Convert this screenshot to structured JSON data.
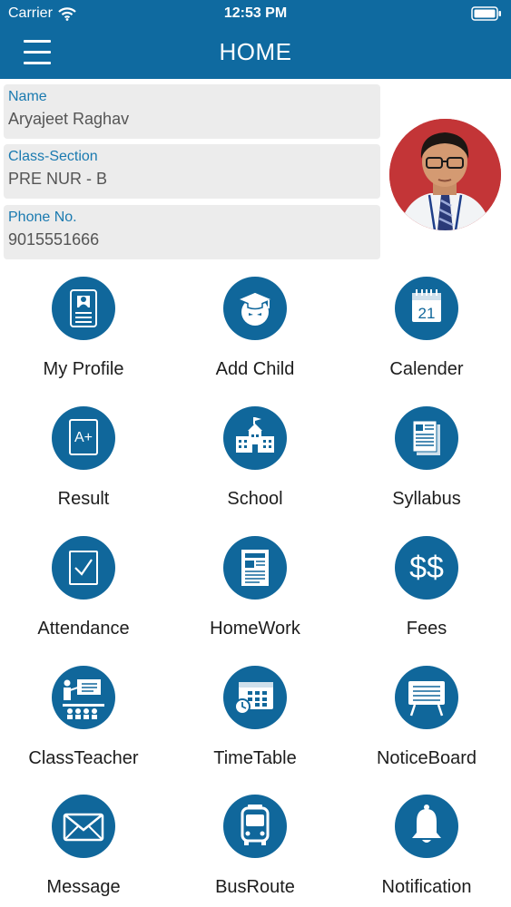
{
  "status_bar": {
    "carrier": "Carrier",
    "time": "12:53 PM"
  },
  "nav": {
    "title": "HOME"
  },
  "profile": {
    "name_label": "Name",
    "name_value": "Aryajeet Raghav",
    "class_label": "Class-Section",
    "class_value": "PRE NUR - B",
    "phone_label": "Phone No.",
    "phone_value": "9015551666"
  },
  "icons": {
    "calendar_day": "21",
    "result_grade": "A+",
    "fees_symbol": "$$"
  },
  "tiles": [
    {
      "label": "My Profile",
      "icon": "profile-icon"
    },
    {
      "label": "Add Child",
      "icon": "graduate-icon"
    },
    {
      "label": "Calender",
      "icon": "calendar-icon"
    },
    {
      "label": "Result",
      "icon": "result-icon"
    },
    {
      "label": "School",
      "icon": "school-icon"
    },
    {
      "label": "Syllabus",
      "icon": "syllabus-icon"
    },
    {
      "label": "Attendance",
      "icon": "attendance-icon"
    },
    {
      "label": "HomeWork",
      "icon": "homework-icon"
    },
    {
      "label": "Fees",
      "icon": "fees-icon"
    },
    {
      "label": "ClassTeacher",
      "icon": "class-teacher-icon"
    },
    {
      "label": "TimeTable",
      "icon": "timetable-icon"
    },
    {
      "label": "NoticeBoard",
      "icon": "notice-board-icon"
    },
    {
      "label": "Message",
      "icon": "message-icon"
    },
    {
      "label": "BusRoute",
      "icon": "bus-icon"
    },
    {
      "label": "Notification",
      "icon": "bell-icon"
    }
  ],
  "colors": {
    "primary": "#0f6aa0",
    "icon_bg": "#10679b",
    "label_blue": "#1a7ab0",
    "card_bg": "#ececec"
  }
}
